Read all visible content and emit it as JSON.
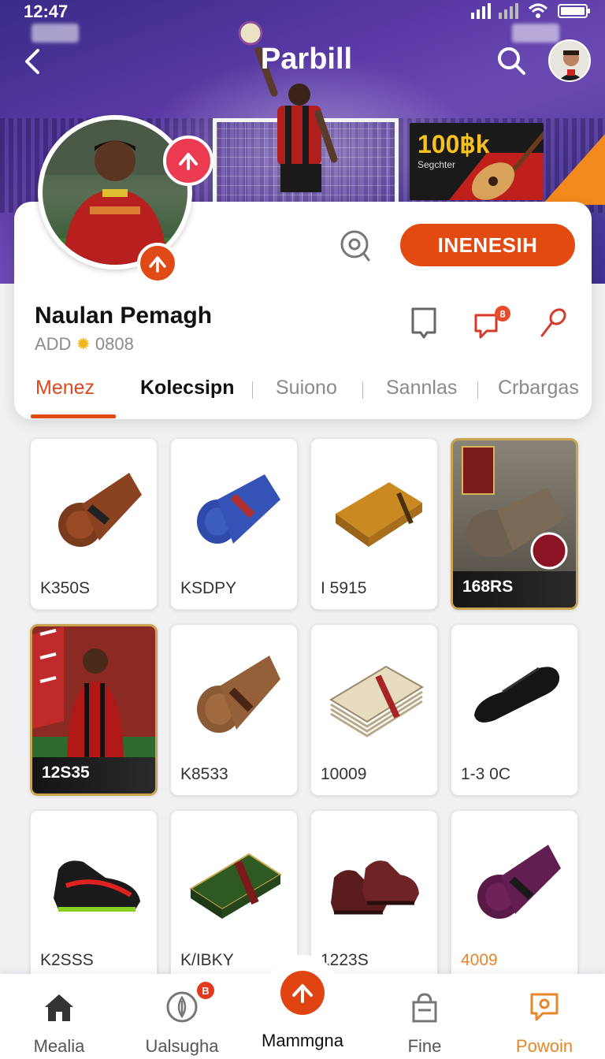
{
  "status_bar": {
    "time": "12:47"
  },
  "header": {
    "title": "Parbill"
  },
  "promo": {
    "value": "100฿k",
    "subtitle": "Segchter"
  },
  "profile": {
    "name": "Naulan Pemagh",
    "meta_left": "ADD",
    "meta_right": "0808",
    "follow_label": "INENESIH"
  },
  "tabs": [
    {
      "label": "Menez"
    },
    {
      "label": "Kolecsipn"
    },
    {
      "label": "Suiono"
    },
    {
      "label": "Sannlas"
    },
    {
      "label": "Crbargas"
    }
  ],
  "items": [
    {
      "label": "K350S",
      "icon": "brown-scarf-roll"
    },
    {
      "label": "KSDPY",
      "icon": "blue-scarf-roll"
    },
    {
      "label": "I 5915",
      "icon": "tan-leather-wallet"
    },
    {
      "label": "168RS",
      "icon": "premium-scarf-card"
    },
    {
      "label": "12S35",
      "icon": "player-card"
    },
    {
      "label": "K8533",
      "icon": "brown-scarf-roll"
    },
    {
      "label": "10009",
      "icon": "banknote-stack"
    },
    {
      "label": "1-3 0C",
      "icon": "black-slipper"
    },
    {
      "label": "K2SSS",
      "icon": "football-boot"
    },
    {
      "label": "K/IBKY",
      "icon": "green-card-pack"
    },
    {
      "label": "1223S",
      "icon": "maroon-shoes"
    },
    {
      "label": "4009",
      "icon": "purple-scarf-roll"
    }
  ],
  "bottom_nav": {
    "items": [
      {
        "label": "Mealia",
        "icon": "home-icon"
      },
      {
        "label": "Ualsugha",
        "icon": "leaf-icon",
        "badge": "B"
      },
      {
        "label": "Mammgna",
        "icon": "up-arrow-icon"
      },
      {
        "label": "Fine",
        "icon": "shop-bag-icon"
      },
      {
        "label": "Powoin",
        "icon": "chat-bubble-icon"
      }
    ]
  },
  "colors": {
    "accent": "#e34a12",
    "hero_purple": "#5a3aa6",
    "premium_gold": "#c9a451",
    "highlight_orange": "#e8862a"
  }
}
